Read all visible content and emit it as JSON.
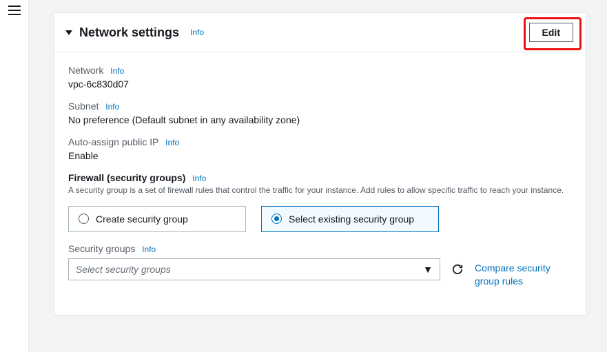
{
  "header": {
    "title": "Network settings",
    "info": "Info",
    "edit": "Edit"
  },
  "fields": {
    "network": {
      "label": "Network",
      "info": "Info",
      "value": "vpc-6c830d07"
    },
    "subnet": {
      "label": "Subnet",
      "info": "Info",
      "value": "No preference (Default subnet in any availability zone)"
    },
    "publicIp": {
      "label": "Auto-assign public IP",
      "info": "Info",
      "value": "Enable"
    }
  },
  "firewall": {
    "heading": "Firewall (security groups)",
    "info": "Info",
    "description": "A security group is a set of firewall rules that control the traffic for your instance. Add rules to allow specific traffic to reach your instance.",
    "options": {
      "create": "Create security group",
      "select_existing": "Select existing security group"
    }
  },
  "securityGroups": {
    "label": "Security groups",
    "info": "Info",
    "placeholder": "Select security groups",
    "compare": "Compare security group rules"
  }
}
